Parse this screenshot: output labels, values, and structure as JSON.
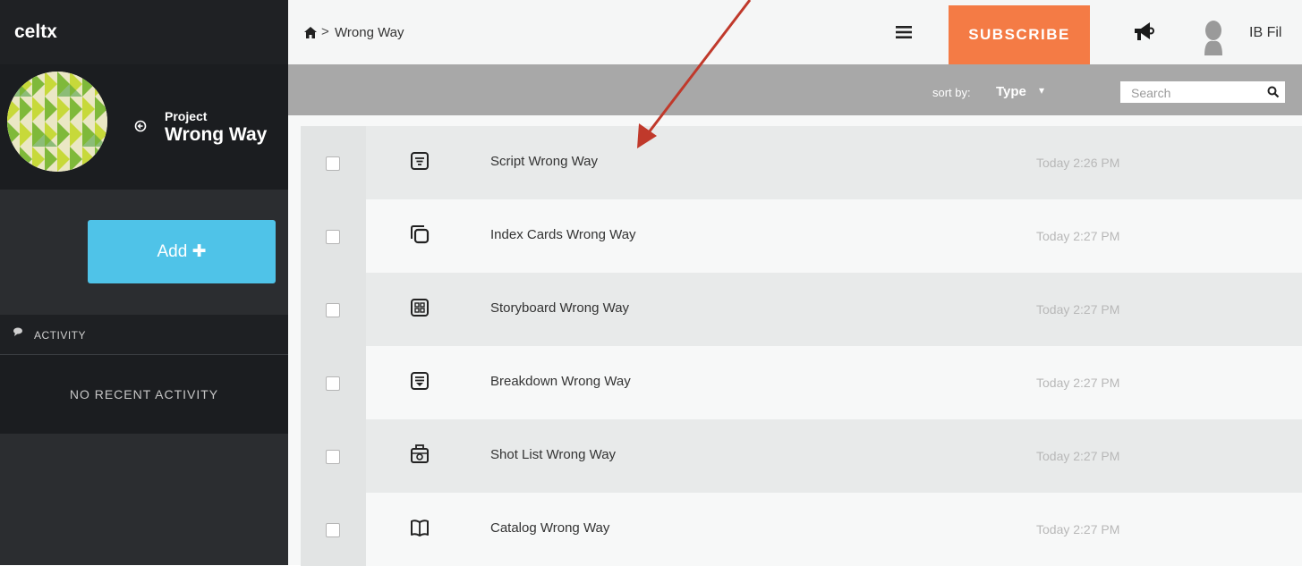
{
  "app": {
    "brand": "celtx"
  },
  "breadcrumb": {
    "separator": ">",
    "current": "Wrong Way"
  },
  "header": {
    "subscribe_label": "SUBSCRIBE",
    "user_name": "IB Fil"
  },
  "project": {
    "label": "Project",
    "name": "Wrong Way"
  },
  "sidebar": {
    "add_label": "Add ✚",
    "activity_label": "ACTIVITY",
    "no_activity": "NO RECENT ACTIVITY"
  },
  "sort": {
    "label": "sort by:",
    "value": "Type",
    "caret": "▾"
  },
  "search": {
    "placeholder": "Search"
  },
  "items": [
    {
      "name": "Script Wrong Way",
      "time": "Today 2:26 PM",
      "icon": "script-icon"
    },
    {
      "name": "Index Cards Wrong Way",
      "time": "Today 2:27 PM",
      "icon": "index-cards-icon"
    },
    {
      "name": "Storyboard Wrong Way",
      "time": "Today 2:27 PM",
      "icon": "storyboard-icon"
    },
    {
      "name": "Breakdown Wrong Way",
      "time": "Today 2:27 PM",
      "icon": "breakdown-icon"
    },
    {
      "name": "Shot List Wrong Way",
      "time": "Today 2:27 PM",
      "icon": "shot-list-icon"
    },
    {
      "name": "Catalog Wrong Way",
      "time": "Today 2:27 PM",
      "icon": "catalog-icon"
    }
  ],
  "colors": {
    "accent": "#f47b45",
    "add_button": "#4fc3e8",
    "sidebar": "#2b2d30",
    "annotation_arrow": "#c0392b"
  }
}
